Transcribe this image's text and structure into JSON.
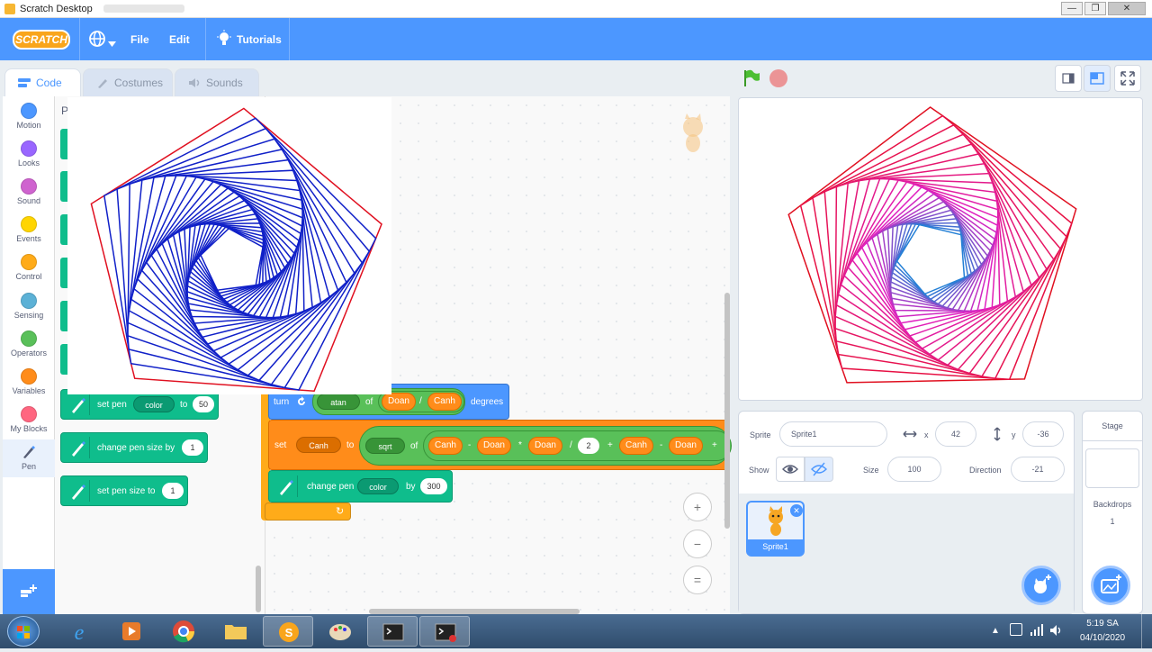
{
  "window": {
    "title": "Scratch Desktop",
    "minimize": "—",
    "maximize": "❐",
    "close": "✕"
  },
  "menubar": {
    "logo": "SCRATCH",
    "file": "File",
    "edit": "Edit",
    "tutorials": "Tutorials"
  },
  "tabs": {
    "code": "Code",
    "costumes": "Costumes",
    "sounds": "Sounds"
  },
  "categories": [
    {
      "label": "Motion",
      "color": "#4c97ff"
    },
    {
      "label": "Looks",
      "color": "#9966ff"
    },
    {
      "label": "Sound",
      "color": "#cf63cf"
    },
    {
      "label": "Events",
      "color": "#ffd500"
    },
    {
      "label": "Control",
      "color": "#ffab19"
    },
    {
      "label": "Sensing",
      "color": "#5cb1d6"
    },
    {
      "label": "Operators",
      "color": "#59c059"
    },
    {
      "label": "Variables",
      "color": "#ff8c1a"
    },
    {
      "label": "My Blocks",
      "color": "#ff6680"
    },
    {
      "label": "Pen",
      "color": "#0fbd8c"
    }
  ],
  "palette": {
    "heading": "P",
    "set_pen_color": {
      "prefix": "set pen",
      "dropdown": "color",
      "to": "to",
      "value": "50"
    },
    "change_pen_size": {
      "label": "change pen size by",
      "value": "1"
    },
    "set_pen_size": {
      "label": "set pen size to",
      "value": "1"
    }
  },
  "script": {
    "turn": {
      "label": "turn",
      "func": "atan",
      "of": "of",
      "a": "Doan",
      "div": "/",
      "b": "Canh",
      "suffix": "degrees"
    },
    "set": {
      "label": "set",
      "var": "Canh",
      "to": "to",
      "func": "sqrt",
      "of": "of",
      "t1": "Canh",
      "minus": "-",
      "t2": "Doan",
      "times": "*",
      "t3": "Doan",
      "div": "/",
      "two": "2",
      "plus": "+",
      "t4": "Canh",
      "minus2": "-",
      "t5": "Doan",
      "plus2": "+"
    },
    "change_pen": {
      "label": "change pen",
      "dropdown": "color",
      "by": "by",
      "value": "300"
    },
    "loop_arrow": "↻"
  },
  "zoom": {
    "in": "+",
    "out": "−",
    "reset": "="
  },
  "sprite": {
    "sprite_label": "Sprite",
    "name": "Sprite1",
    "x_label": "x",
    "x": "42",
    "y_label": "y",
    "y": "-36",
    "show_label": "Show",
    "size_label": "Size",
    "size": "100",
    "direction_label": "Direction",
    "direction": "-21",
    "thumb_name": "Sprite1"
  },
  "stage_panel": {
    "title": "Stage",
    "backdrops_label": "Backdrops",
    "backdrops_count": "1"
  },
  "taskbar": {
    "time": "5:19 SA",
    "date": "04/10/2020"
  },
  "colors": {
    "accent": "#4c97ff",
    "pen_green": "#0fbd8c",
    "operators": "#59c059",
    "variables": "#ff8c1a",
    "control": "#ffab19"
  }
}
